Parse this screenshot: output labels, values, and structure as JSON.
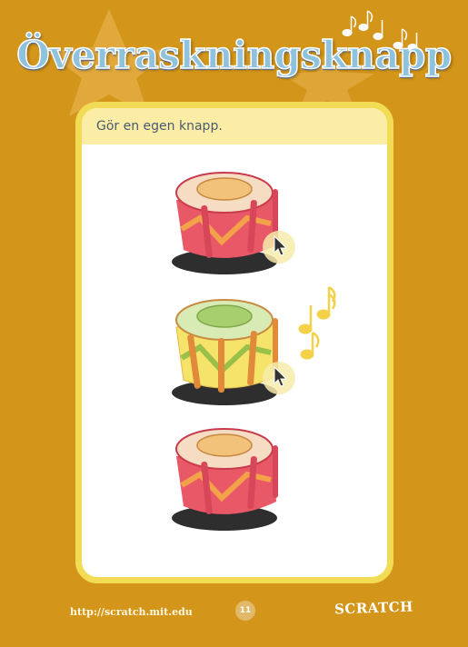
{
  "page": {
    "title": "Överraskningsknapp",
    "instruction": "Gör en egen knapp.",
    "footer_url": "http://scratch.mit.edu",
    "page_number": "11",
    "logo_text": "SCRATCH"
  },
  "colors": {
    "background": "#d4961a",
    "card_border": "#f3dc55",
    "card_header": "#fbeda6",
    "title_fill": "#8fc3dd",
    "drum_red": "#e85866",
    "drum_highlight_yellow": "#f6e46a"
  },
  "illustrations": [
    {
      "name": "drum",
      "state": "normal",
      "cursor": "pointer"
    },
    {
      "name": "drum",
      "state": "highlighted",
      "cursor": "pointer",
      "music_notes": true
    },
    {
      "name": "drum",
      "state": "normal",
      "cursor": "none"
    }
  ]
}
